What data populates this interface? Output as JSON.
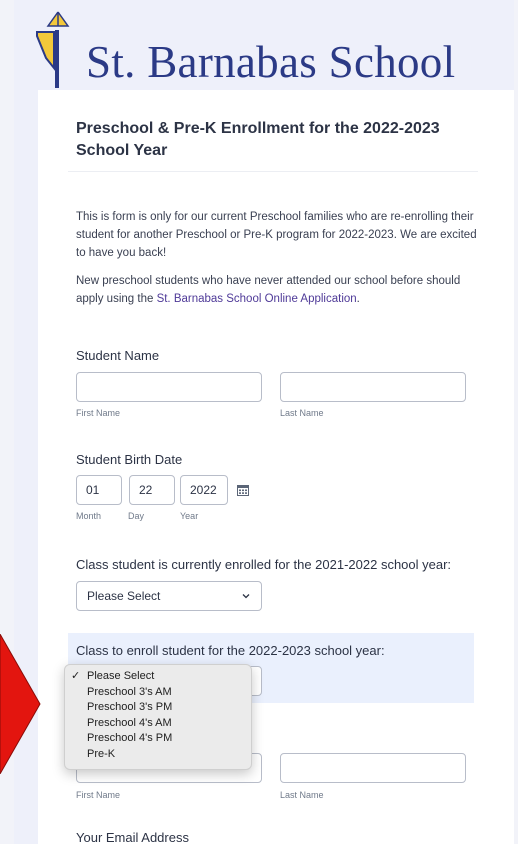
{
  "school": {
    "name": "St. Barnabas School",
    "colors": {
      "navy": "#2b3a86",
      "gold": "#f3c83a"
    }
  },
  "form": {
    "title": "Preschool & Pre-K Enrollment for the 2022-2023 School Year",
    "intro_p1": "This is form is only for our current Preschool families who are re-enrolling their student for another Preschool or Pre-K program for 2022-2023. We are excited to have you back!",
    "intro_p2_before": "New preschool students who have never attended our school before should apply using the ",
    "intro_p2_link": "St. Barnabas School Online Application",
    "intro_p2_after": "."
  },
  "student_name": {
    "label": "Student Name",
    "first": {
      "value": "",
      "sublabel": "First Name"
    },
    "last": {
      "value": "",
      "sublabel": "Last Name"
    }
  },
  "birth_date": {
    "label": "Student Birth Date",
    "month": {
      "value": "01",
      "sublabel": "Month"
    },
    "day": {
      "value": "22",
      "sublabel": "Day"
    },
    "year": {
      "value": "2022",
      "sublabel": "Year"
    },
    "calendar_icon": "calendar-icon"
  },
  "current_class": {
    "label": "Class student is currently enrolled for the 2021-2022 school year:",
    "selected": "Please Select"
  },
  "enroll_class": {
    "label": "Class to enroll student for the 2022-2023 school year:",
    "options": [
      "Please Select",
      "Preschool 3's AM",
      "Preschool 3's PM",
      "Preschool 4's AM",
      "Preschool 4's PM",
      "Pre-K"
    ],
    "checked_index": 0
  },
  "parent_name": {
    "first": {
      "value": "",
      "sublabel": "First Name"
    },
    "last": {
      "value": "",
      "sublabel": "Last Name"
    }
  },
  "email": {
    "label": "Your Email Address"
  },
  "annotation": {
    "arrow_color": "#e3150f"
  }
}
